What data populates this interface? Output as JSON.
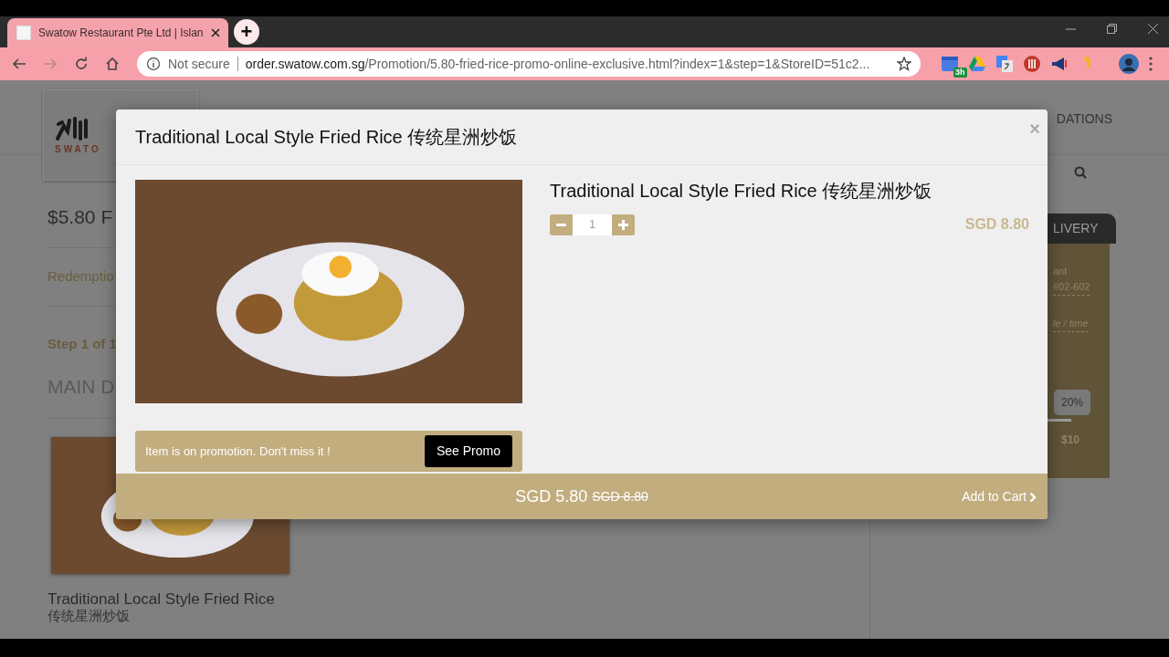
{
  "browser": {
    "tab_title": "Swatow Restaurant Pte Ltd | Islan",
    "new_tab": "+",
    "url": {
      "security": "Not secure",
      "host": "order.swatow.com.sg",
      "path": "/Promotion/5.80-fried-rice-promo-online-exclusive.html?index=1&step=1&StoreID=51c2..."
    },
    "extension_badge": "3h"
  },
  "page": {
    "logo_text": "SWATO",
    "nav_partial": "DATIONS",
    "promo_title": "$5.80 F",
    "redemption": "Redemptio",
    "step": "Step 1 of 1",
    "section": "MAIN D",
    "product": {
      "name": "Traditional Local Style Fried Rice",
      "name_cn": "传统星洲炒饭"
    },
    "side_panel": {
      "tab": "LIVERY",
      "lines": [
        "ant",
        "#02-602",
        "le / time"
      ],
      "discount": "20%",
      "threshold": "$10"
    }
  },
  "modal": {
    "title": "Traditional Local Style Fried Rice 传统星洲炒饭",
    "close": "×",
    "item_name": "Traditional Local Style Fried Rice 传统星洲炒饭",
    "quantity": "1",
    "price": "SGD 8.80",
    "promo_message": "Item is on promotion. Don't miss it !",
    "promo_button": "See Promo",
    "total": "SGD 5.80",
    "original_total": "SGD 8.80",
    "add_to_cart": "Add to Cart"
  }
}
